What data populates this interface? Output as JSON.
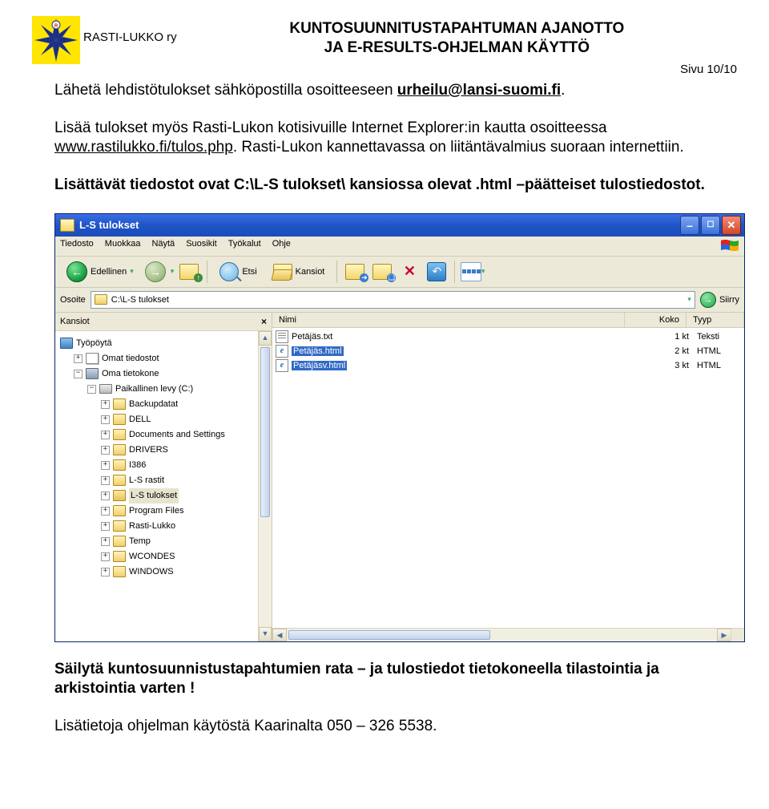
{
  "header": {
    "org": "RASTI-LUKKO ry",
    "title_line1": "KUNTOSUUNNITUSTAPAHTUMAN AJANOTTO",
    "title_line2": "JA E-RESULTS-OHJELMAN KÄYTTÖ",
    "page": "Sivu 10/10"
  },
  "body": {
    "p1a": "Lähetä lehdistötulokset sähköpostilla osoitteeseen ",
    "p1b": "urheilu@lansi-suomi.fi",
    "p1c": ".",
    "p2a": "Lisää tulokset myös Rasti-Lukon kotisivuille Internet Explorer:in kautta osoitteessa ",
    "p2b": "www.rastilukko.fi/tulos.php",
    "p2c": ". Rasti-Lukon kannettavassa on liitäntävalmius suoraan internettiin.",
    "p3": "Lisättävät tiedostot ovat C:\\L-S tulokset\\ kansiossa olevat .html –päätteiset tulostiedostot.",
    "p4": "Säilytä kuntosuunnistustapahtumien rata – ja tulostiedot tietokoneella tilastointia ja arkistointia varten !",
    "p5": "Lisätietoja ohjelman käytöstä Kaarinalta 050 – 326 5538."
  },
  "win": {
    "title": "L-S tulokset",
    "menu": [
      "Tiedosto",
      "Muokkaa",
      "Näytä",
      "Suosikit",
      "Työkalut",
      "Ohje"
    ],
    "toolbar": {
      "back": "Edellinen",
      "search": "Etsi",
      "folders": "Kansiot"
    },
    "addr_label": "Osoite",
    "addr_value": "C:\\L-S tulokset",
    "go": "Siirry",
    "left_header": "Kansiot",
    "tree": {
      "desktop": "Työpöytä",
      "mydocs": "Omat tiedostot",
      "mycomp": "Oma tietokone",
      "drive": "Paikallinen levy (C:)",
      "folders": [
        "Backupdatat",
        "DELL",
        "Documents and Settings",
        "DRIVERS",
        "I386",
        "L-S rastit",
        "L-S tulokset",
        "Program Files",
        "Rasti-Lukko",
        "Temp",
        "WCONDES",
        "WINDOWS"
      ],
      "selected": "L-S tulokset"
    },
    "cols": {
      "name": "Nimi",
      "size": "Koko",
      "type": "Tyyp"
    },
    "files": [
      {
        "name": "Petäjäs.txt",
        "size": "1 kt",
        "type": "Teksti",
        "icon": "txt",
        "sel": false
      },
      {
        "name": "Petäjäs.html",
        "size": "2 kt",
        "type": "HTML",
        "icon": "ie",
        "sel": true
      },
      {
        "name": "Petäjäsv.html",
        "size": "3 kt",
        "type": "HTML",
        "icon": "ie",
        "sel": true
      }
    ]
  }
}
